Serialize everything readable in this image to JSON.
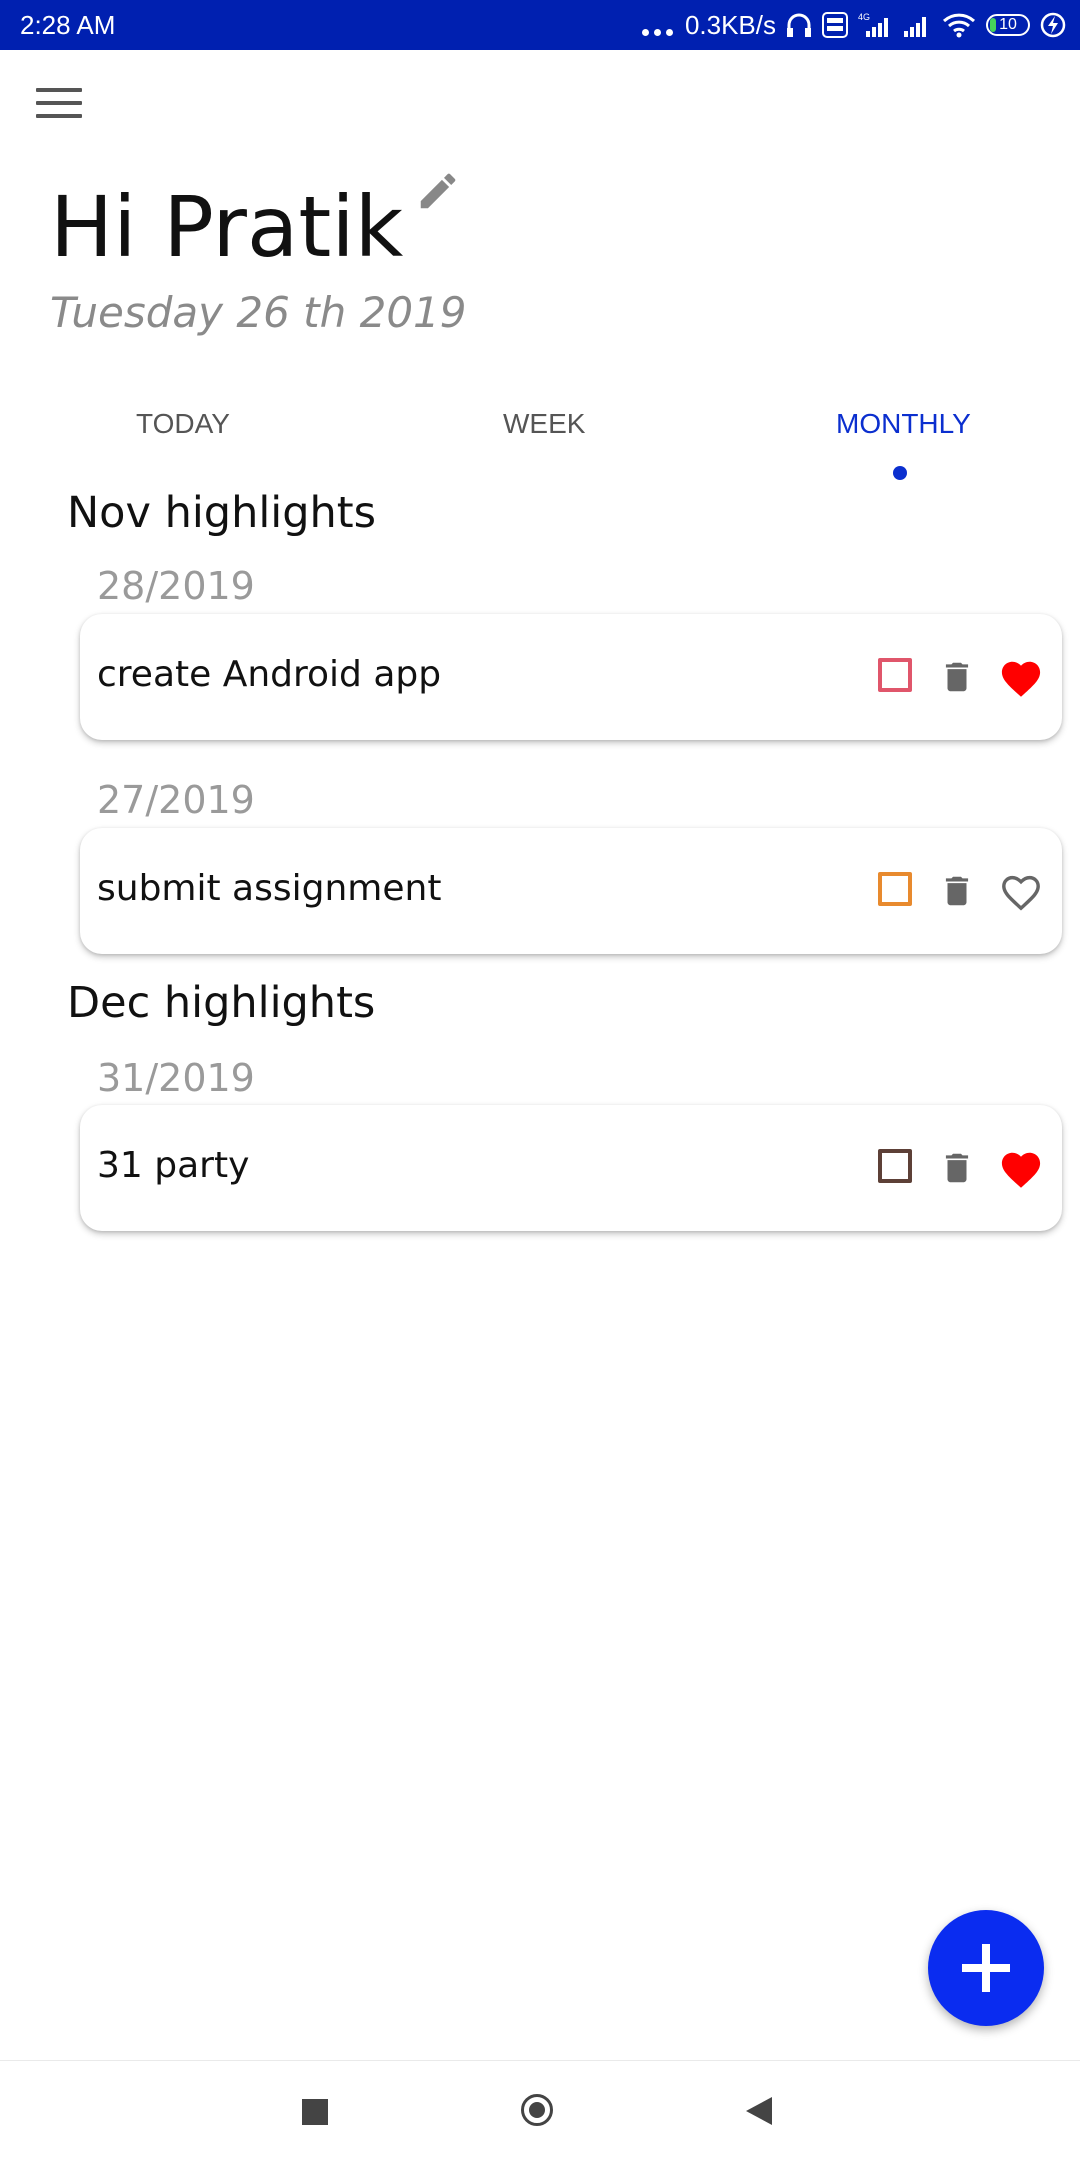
{
  "status_bar": {
    "time": "2:28 AM",
    "network_speed": "0.3KB/s",
    "battery": "10",
    "network_type": "4G"
  },
  "header": {
    "greeting": "Hi Pratik",
    "date": "Tuesday 26 th 2019"
  },
  "tabs": [
    {
      "label": "TODAY",
      "active": false
    },
    {
      "label": "WEEK",
      "active": false
    },
    {
      "label": "MONTHLY",
      "active": true
    }
  ],
  "sections": [
    {
      "title": "Nov highlights",
      "groups": [
        {
          "date": "28/2019",
          "task": {
            "title": "create Android app",
            "checkbox_color": "#e0566b",
            "favorite": true
          }
        },
        {
          "date": "27/2019",
          "task": {
            "title": "submit assignment",
            "checkbox_color": "#e88a2e",
            "favorite": false
          }
        }
      ]
    },
    {
      "title": "Dec highlights",
      "groups": [
        {
          "date": "31/2019",
          "task": {
            "title": "31 party",
            "checkbox_color": "#5d4037",
            "favorite": true
          }
        }
      ]
    }
  ],
  "colors": {
    "accent": "#0b2fcf",
    "status_bar": "#0020b0",
    "fab": "#0a2cf0",
    "heart_active": "#ff0000"
  },
  "icons": {
    "menu": "hamburger-menu-icon",
    "edit": "pencil-icon",
    "delete": "trash-icon",
    "favorite": "heart-icon",
    "add": "plus-icon"
  }
}
